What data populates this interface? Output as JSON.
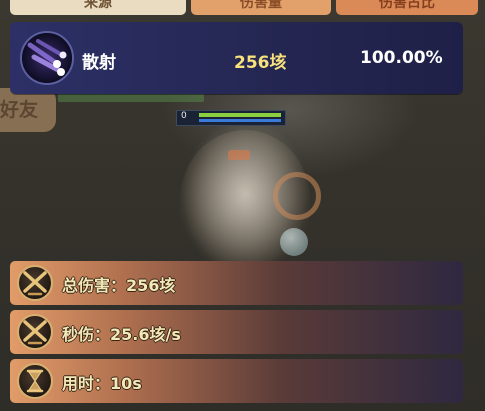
{
  "tabs": [
    {
      "label": "来源"
    },
    {
      "label": "伤害量"
    },
    {
      "label": "伤害占比"
    }
  ],
  "skill": {
    "name": "散射",
    "damage": "256垓",
    "percent": "100.00%",
    "icon": "meteor-scatter-icon"
  },
  "stats": {
    "total_damage": "总伤害：256垓",
    "dps": "秒伤：25.6垓/s",
    "duration": "用时：10s"
  },
  "background": {
    "friend_button": "好友",
    "level": "0"
  },
  "colors": {
    "skill_card": "#262956",
    "damage_yellow": "#f7e27c",
    "stat_label": "#f2e9b8",
    "stat_gradient_start": "#e29c69"
  }
}
